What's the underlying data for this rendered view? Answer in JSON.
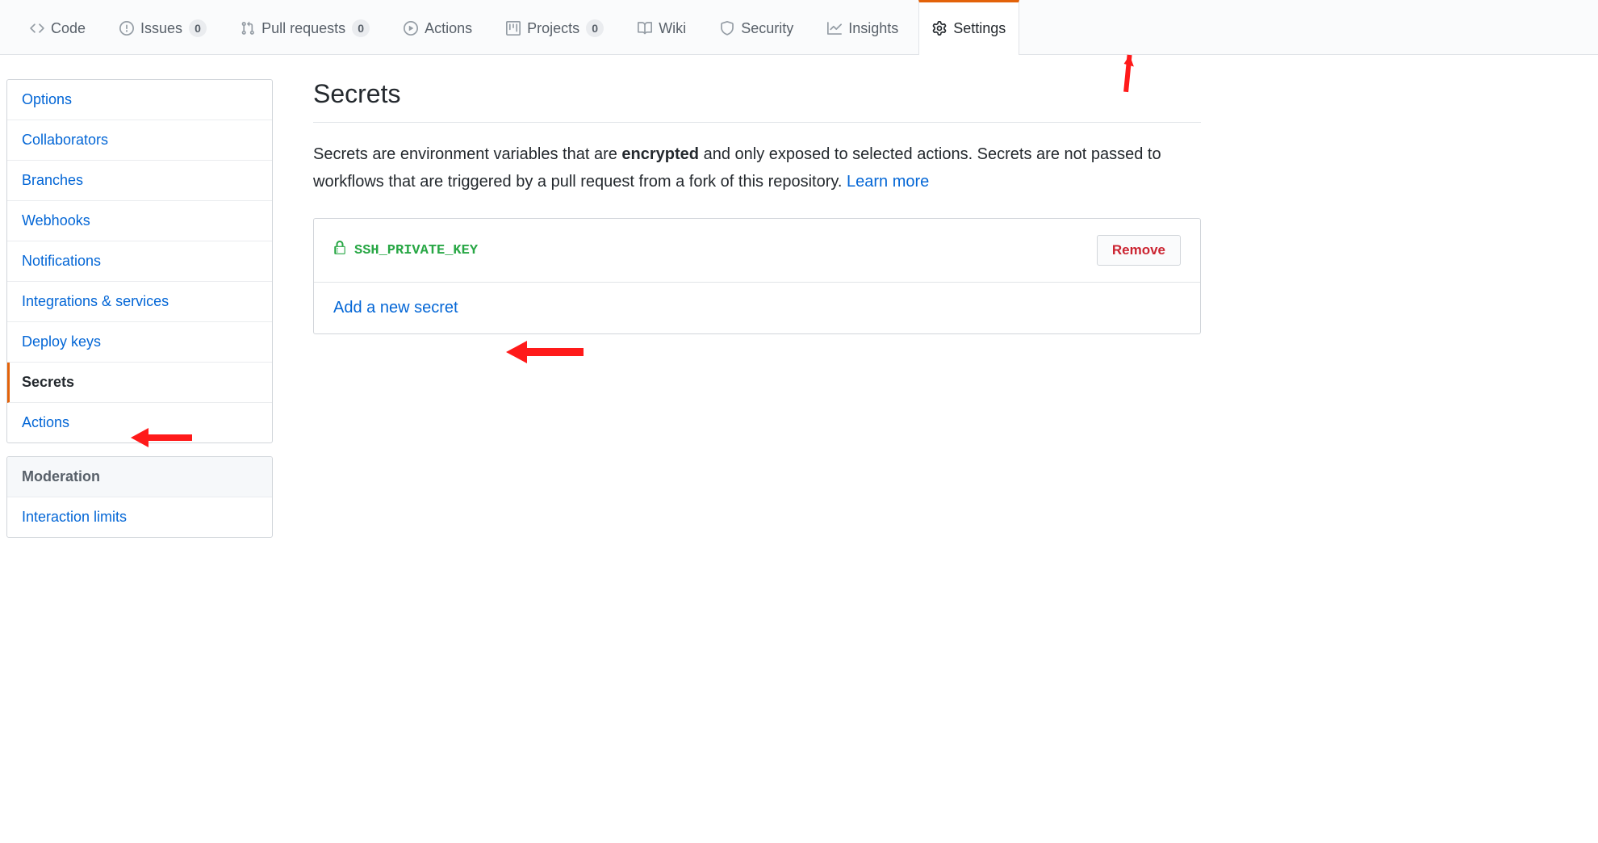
{
  "tabs": [
    {
      "id": "code",
      "label": "Code",
      "count": null
    },
    {
      "id": "issues",
      "label": "Issues",
      "count": "0"
    },
    {
      "id": "pulls",
      "label": "Pull requests",
      "count": "0"
    },
    {
      "id": "actions",
      "label": "Actions",
      "count": null
    },
    {
      "id": "projects",
      "label": "Projects",
      "count": "0"
    },
    {
      "id": "wiki",
      "label": "Wiki",
      "count": null
    },
    {
      "id": "security",
      "label": "Security",
      "count": null
    },
    {
      "id": "insights",
      "label": "Insights",
      "count": null
    },
    {
      "id": "settings",
      "label": "Settings",
      "count": null
    }
  ],
  "sidebar": {
    "items": [
      "Options",
      "Collaborators",
      "Branches",
      "Webhooks",
      "Notifications",
      "Integrations & services",
      "Deploy keys",
      "Secrets",
      "Actions"
    ],
    "moderation_heading": "Moderation",
    "moderation_items": [
      "Interaction limits"
    ]
  },
  "page": {
    "title": "Secrets",
    "desc_before": "Secrets are environment variables that are ",
    "desc_bold": "encrypted",
    "desc_after": " and only exposed to selected actions. Secrets are not passed to workflows that are triggered by a pull request from a fork of this repository. ",
    "learn_more": "Learn more"
  },
  "secrets": [
    {
      "name": "SSH_PRIVATE_KEY",
      "remove_label": "Remove"
    }
  ],
  "add_secret_label": "Add a new secret"
}
